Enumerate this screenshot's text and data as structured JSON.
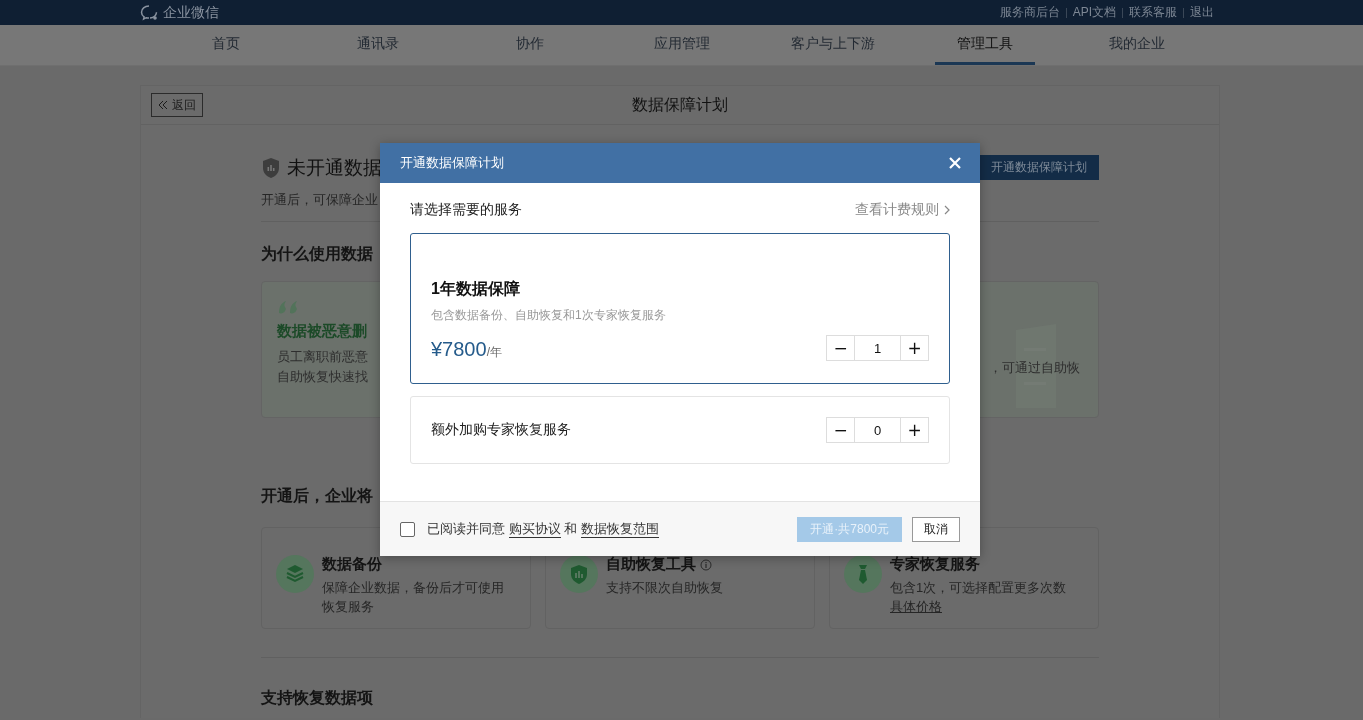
{
  "topbar": {
    "logo": "企业微信",
    "links": [
      "服务商后台",
      "API文档",
      "联系客服",
      "退出"
    ]
  },
  "nav": [
    {
      "label": "首页",
      "selected": false
    },
    {
      "label": "通讯录",
      "selected": false
    },
    {
      "label": "协作",
      "selected": false
    },
    {
      "label": "应用管理",
      "selected": false
    },
    {
      "label": "客户与上下游",
      "selected": false
    },
    {
      "label": "管理工具",
      "selected": true
    },
    {
      "label": "我的企业",
      "selected": false
    }
  ],
  "page": {
    "back": "返回",
    "title": "数据保障计划",
    "status": {
      "title": "未开通数据",
      "description": "开通后，可保障企业",
      "button": "开通数据保障计划"
    },
    "why": {
      "heading": "为什么使用数据",
      "cases": [
        {
          "kind": "quote",
          "title": "数据被恶意删",
          "lines": [
            "员工离职前恶意",
            "自助恢复快速找"
          ]
        },
        {
          "kind": "illustrated",
          "lines": [
            "，可通过自助恢"
          ]
        }
      ]
    },
    "benefits": {
      "heading": "开通后，企业将",
      "items": [
        {
          "kind": "backup",
          "title": "数据备份",
          "text": "保障企业数据，备份后才可使用恢复服务"
        },
        {
          "kind": "self_service",
          "title": "自助恢复工具",
          "text": "支持不限次自助恢复",
          "info": true
        },
        {
          "kind": "expert",
          "title": "专家恢复服务",
          "text": "包含1次，可选择配置更多次数",
          "link": "具体价格"
        }
      ]
    },
    "data_items_heading": "支持恢复数据项"
  },
  "dialog": {
    "title": "开通数据保障计划",
    "prompt": "请选择需要的服务",
    "rules_link": "查看计费规则",
    "options": [
      {
        "kind": "plan",
        "title": "1年数据保障",
        "description": "包含数据备份、自助恢复和1次专家恢复服务",
        "price": "¥7800",
        "unit": "/年",
        "minus": "−",
        "quantity": "1",
        "plus": "+",
        "selected": true
      },
      {
        "kind": "addon",
        "title": "额外加购专家恢复服务",
        "minus": "−",
        "quantity": "0",
        "plus": "+",
        "selected": false
      }
    ],
    "agreement": {
      "checked": false,
      "parts": [
        {
          "kind": "text",
          "text": "已阅读并同意"
        },
        {
          "kind": "link",
          "text": "购买协议"
        },
        {
          "kind": "text",
          "text": "和"
        },
        {
          "kind": "link",
          "text": "数据恢复范围"
        }
      ]
    },
    "confirm": {
      "label": "开通·共7800元",
      "disabled": true
    },
    "cancel": "取消"
  }
}
